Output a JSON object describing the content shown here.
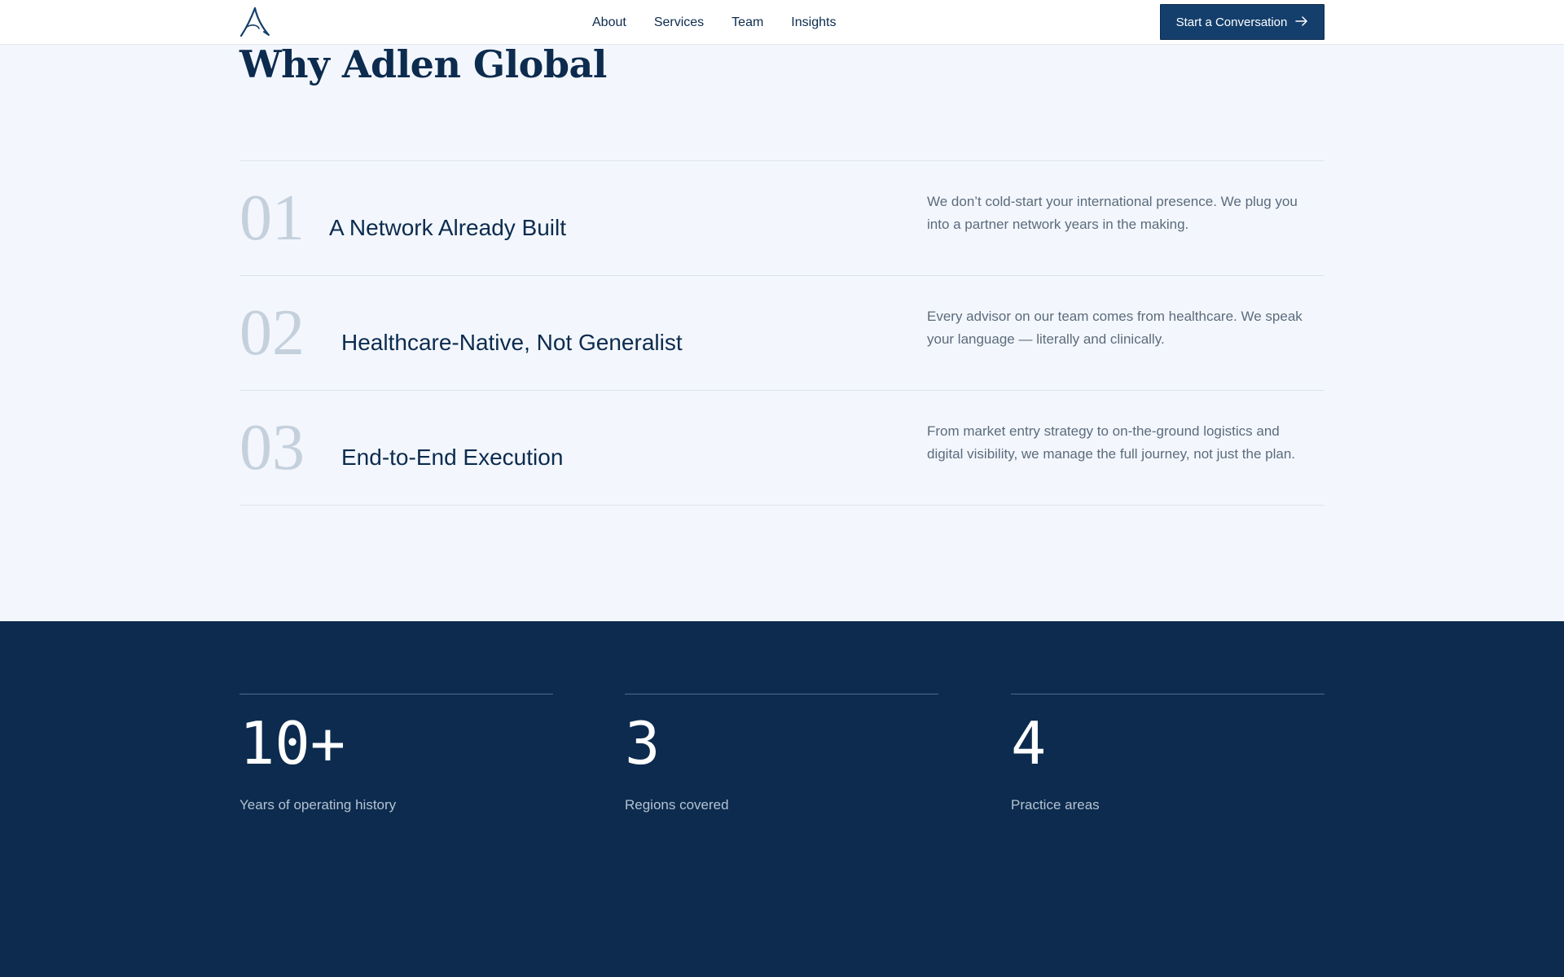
{
  "nav": {
    "logo_icon": "adlen-a-logo-icon",
    "links": [
      "About",
      "Services",
      "Team",
      "Insights"
    ],
    "cta_label": "Start a Conversation",
    "cta_icon": "arrow-right-icon"
  },
  "section": {
    "title": "Why Adlen Global"
  },
  "reasons": [
    {
      "number": "01",
      "title": "A Network Already Built",
      "description": "We don’t cold-start your international presence. We plug you into a partner network years in the making."
    },
    {
      "number": "02",
      "title": "Healthcare-Native, Not Generalist",
      "description": "Every advisor on our team comes from healthcare. We speak your language — literally and clinically."
    },
    {
      "number": "03",
      "title": "End-to-End Execution",
      "description": "From market entry strategy to on-the-ground logistics and digital visibility, we manage the full journey, not just the plan."
    }
  ],
  "stats": [
    {
      "value": "10+",
      "label": "Years of operating history"
    },
    {
      "value": "3",
      "label": "Regions covered"
    },
    {
      "value": "4",
      "label": "Practice areas"
    }
  ],
  "colors": {
    "navy": "#0c2b4e",
    "button": "#143f6c",
    "page_background": "#f3f7fd",
    "number_gray": "#c5d0dd"
  }
}
